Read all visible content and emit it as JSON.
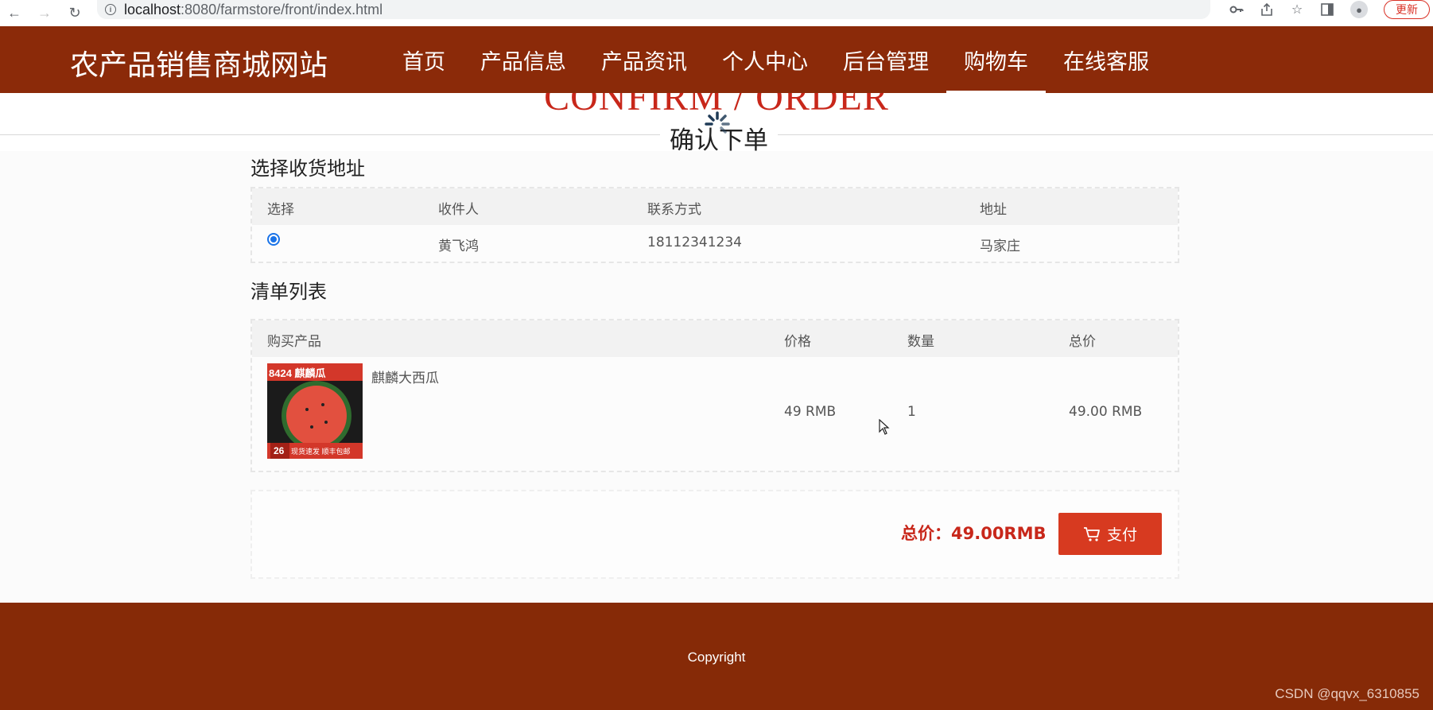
{
  "browser": {
    "url_host": "localhost",
    "url_rest": ":8080/farmstore/front/index.html",
    "update_label": "更新"
  },
  "site": {
    "logo": "农产品销售商城网站",
    "menu": [
      {
        "label": "首页",
        "active": false
      },
      {
        "label": "产品信息",
        "active": false
      },
      {
        "label": "产品资讯",
        "active": false
      },
      {
        "label": "个人中心",
        "active": false
      },
      {
        "label": "后台管理",
        "active": false
      },
      {
        "label": "购物车",
        "active": true
      },
      {
        "label": "在线客服",
        "active": false
      }
    ]
  },
  "page": {
    "title_en": "CONFIRM / ORDER",
    "title_cn": "确认下单"
  },
  "address": {
    "section_title": "选择收货地址",
    "headers": [
      "选择",
      "收件人",
      "联系方式",
      "地址"
    ],
    "rows": [
      {
        "selected": true,
        "recipient": "黄飞鸿",
        "phone": "18112341234",
        "address": "马家庄"
      }
    ]
  },
  "order": {
    "section_title": "清单列表",
    "headers": [
      "购买产品",
      "价格",
      "数量",
      "总价"
    ],
    "items": [
      {
        "name": "麒麟大西瓜",
        "price": "49 RMB",
        "qty": "1",
        "total": "49.00 RMB",
        "image_text_top": "8424 麒麟瓜",
        "image_text_bottom": "现货速发 顺丰包邮",
        "image_badge": "26"
      }
    ]
  },
  "summary": {
    "total_label": "总价：49.00RMB",
    "pay_label": "支付"
  },
  "footer": {
    "copyright": "Copyright",
    "watermark": "CSDN @qqvx_6310855"
  },
  "colors": {
    "header_bg": "#8b2a09",
    "footer_bg": "#862a07",
    "accent_red": "#c8271a",
    "pay_button": "#d73a20"
  }
}
